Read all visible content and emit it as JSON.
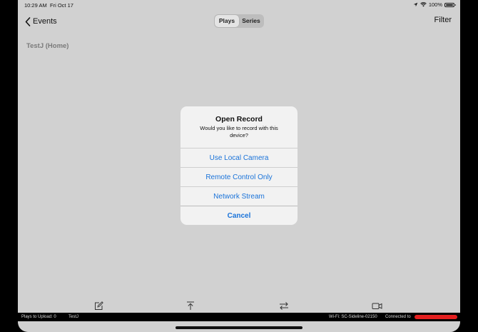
{
  "status_bar": {
    "time": "10:29 AM",
    "date": "Fri Oct 17",
    "battery": "100%",
    "battery_level": 1.0
  },
  "nav": {
    "back_label": "Events",
    "segments": [
      "Plays",
      "Series"
    ],
    "selected_segment": "Plays",
    "filter_label": "Filter"
  },
  "content": {
    "team_label": "TestJ (Home)"
  },
  "alert": {
    "title": "Open Record",
    "message": "Would you like to record with this device?",
    "buttons": [
      "Use Local Camera",
      "Remote Control Only",
      "Network Stream"
    ],
    "cancel_label": "Cancel"
  },
  "toolbar": {
    "icons": [
      "compose-icon",
      "upload-icon",
      "swap-icon",
      "video-camera-icon"
    ]
  },
  "info_bar": {
    "plays_to_upload": "Plays to Upload: 0",
    "team": "TestJ",
    "wifi": "Wi-Fi: SC-Sideline-02150",
    "connected": "Connected to"
  },
  "colors": {
    "accent": "#1a73d9",
    "background": "#d1d1d1",
    "alert_bg": "#f2f2f2",
    "redaction": "#e41f1f"
  }
}
